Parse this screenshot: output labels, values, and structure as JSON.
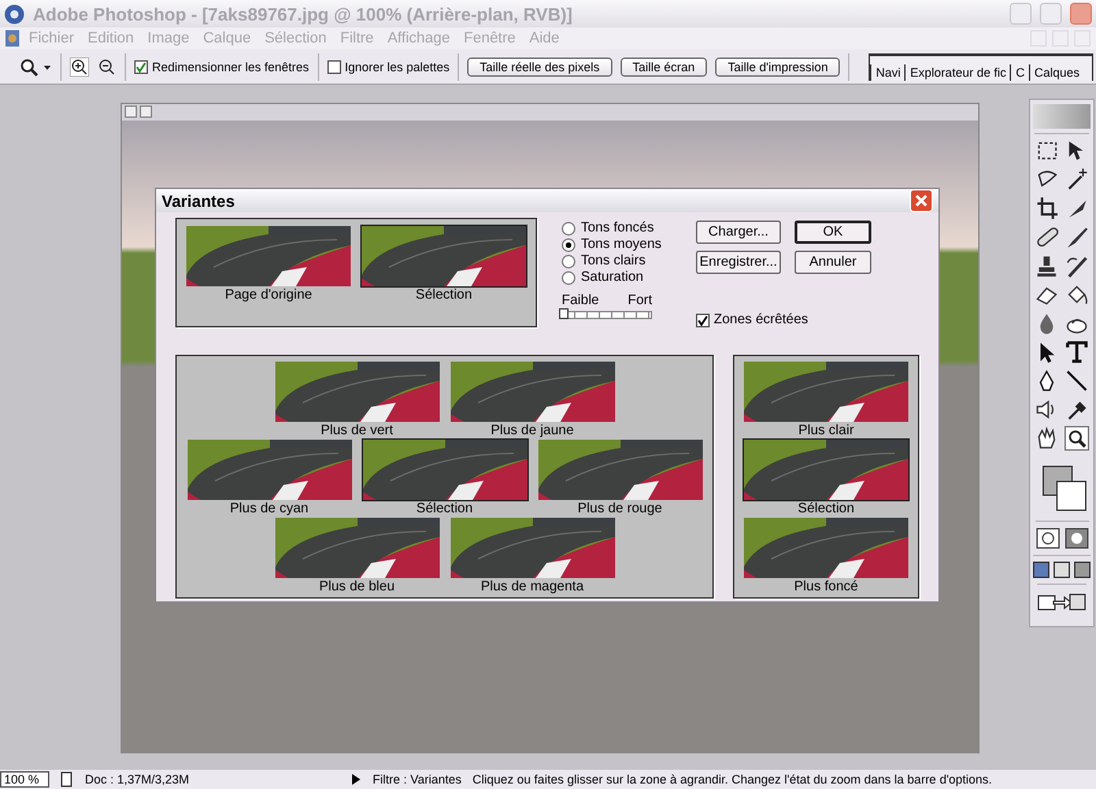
{
  "title_bar": {
    "title": "Adobe Photoshop - [7aks89767.jpg @ 100% (Arrière-plan, RVB)]"
  },
  "menu": [
    {
      "label": "Fichier"
    },
    {
      "label": "Edition"
    },
    {
      "label": "Image"
    },
    {
      "label": "Calque"
    },
    {
      "label": "Sélection"
    },
    {
      "label": "Filtre"
    },
    {
      "label": "Affichage"
    },
    {
      "label": "Fenêtre"
    },
    {
      "label": "Aide"
    }
  ],
  "options_bar": {
    "checkboxes": [
      {
        "label": "Redimensionner les fenêtres",
        "checked": true
      },
      {
        "label": "Ignorer les palettes",
        "checked": false
      }
    ],
    "buttons": [
      {
        "label": "Taille réelle des pixels"
      },
      {
        "label": "Taille écran"
      },
      {
        "label": "Taille d'impression"
      }
    ],
    "palette_tabs": [
      {
        "label": "Navi"
      },
      {
        "label": "Explorateur de fic"
      },
      {
        "label": "C"
      },
      {
        "label": "Calques"
      }
    ]
  },
  "toolbox": {
    "tools": [
      {
        "selected": false
      },
      {
        "selected": false
      },
      {
        "selected": false
      },
      {
        "selected": false
      },
      {
        "selected": false
      },
      {
        "selected": false
      },
      {
        "selected": false
      },
      {
        "selected": false
      },
      {
        "selected": false
      },
      {
        "selected": false
      },
      {
        "selected": false
      },
      {
        "selected": false
      },
      {
        "selected": false
      },
      {
        "selected": false
      },
      {
        "selected": false
      },
      {
        "selected": false
      },
      {
        "selected": false
      },
      {
        "selected": false
      },
      {
        "selected": false
      },
      {
        "selected": false
      },
      {
        "selected": false
      },
      {
        "selected": true
      }
    ]
  },
  "dialog": {
    "title": "Variantes",
    "original": [
      {
        "label": "Page d'origine",
        "selected": false
      },
      {
        "label": "Sélection",
        "selected": true
      }
    ],
    "tones": [
      {
        "label": "Tons foncés",
        "selected": false
      },
      {
        "label": "Tons moyens",
        "selected": true
      },
      {
        "label": "Tons clairs",
        "selected": false
      },
      {
        "label": "Saturation",
        "selected": false
      }
    ],
    "slider": {
      "min_label": "Faible",
      "max_label": "Fort",
      "level": 0
    },
    "buttons": [
      {
        "label": "Charger...",
        "kind": "normal"
      },
      {
        "label": "OK",
        "kind": "default"
      },
      {
        "label": "Enregistrer...",
        "kind": "normal"
      },
      {
        "label": "Annuler",
        "kind": "normal"
      }
    ],
    "clipping": {
      "label": "Zones écrêtées",
      "checked": true
    },
    "color_rows": [
      {
        "items": [
          {
            "label": "Plus de vert",
            "selected": false
          },
          {
            "label": "Plus de jaune",
            "selected": false
          }
        ]
      },
      {
        "items": [
          {
            "label": "Plus de cyan",
            "selected": false
          },
          {
            "label": "Sélection",
            "selected": true
          },
          {
            "label": "Plus de rouge",
            "selected": false
          }
        ]
      },
      {
        "items": [
          {
            "label": "Plus de bleu",
            "selected": false
          },
          {
            "label": "Plus de magenta",
            "selected": false
          }
        ]
      }
    ],
    "brightness": [
      {
        "label": "Plus clair",
        "selected": false
      },
      {
        "label": "Sélection",
        "selected": true
      },
      {
        "label": "Plus foncé",
        "selected": false
      }
    ]
  },
  "status_bar": {
    "zoom": "100 %",
    "doc": "Doc : 1,37M/3,23M",
    "filter": "Filtre : Variantes",
    "message": "Cliquez ou faites glisser sur la zone à agrandir. Changez l'état du zoom dans la barre d'options."
  }
}
